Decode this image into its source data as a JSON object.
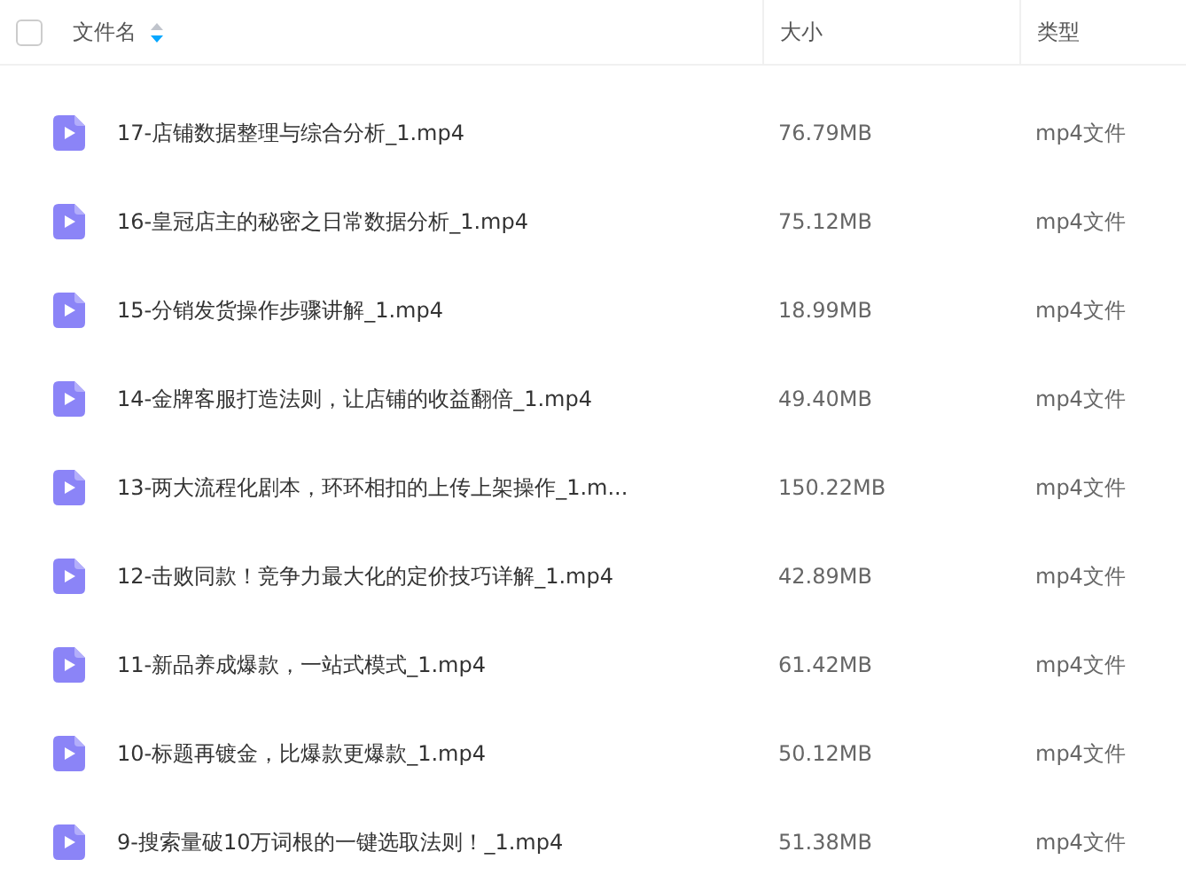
{
  "header": {
    "select_all": {
      "checked": false
    },
    "columns": [
      {
        "label": "文件名",
        "sorted_descending": true
      },
      {
        "label": "大小"
      },
      {
        "label": "类型"
      }
    ]
  },
  "rows": [
    {
      "name": "17-店铺数据整理与综合分析_1.mp4",
      "size": "76.79MB",
      "type": "mp4文件"
    },
    {
      "name": "16-皇冠店主的秘密之日常数据分析_1.mp4",
      "size": "75.12MB",
      "type": "mp4文件"
    },
    {
      "name": "15-分销发货操作步骤讲解_1.mp4",
      "size": "18.99MB",
      "type": "mp4文件"
    },
    {
      "name": "14-金牌客服打造法则，让店铺的收益翻倍_1.mp4",
      "size": "49.40MB",
      "type": "mp4文件"
    },
    {
      "name": "13-两大流程化剧本，环环相扣的上传上架操作_1.m...",
      "size": "150.22MB",
      "type": "mp4文件"
    },
    {
      "name": "12-击败同款！竞争力最大化的定价技巧详解_1.mp4",
      "size": "42.89MB",
      "type": "mp4文件"
    },
    {
      "name": "11-新品养成爆款，一站式模式_1.mp4",
      "size": "61.42MB",
      "type": "mp4文件"
    },
    {
      "name": "10-标题再镀金，比爆款更爆款_1.mp4",
      "size": "50.12MB",
      "type": "mp4文件"
    },
    {
      "name": "9-搜索量破10万词根的一键选取法则！_1.mp4",
      "size": "51.38MB",
      "type": "mp4文件"
    }
  ]
}
